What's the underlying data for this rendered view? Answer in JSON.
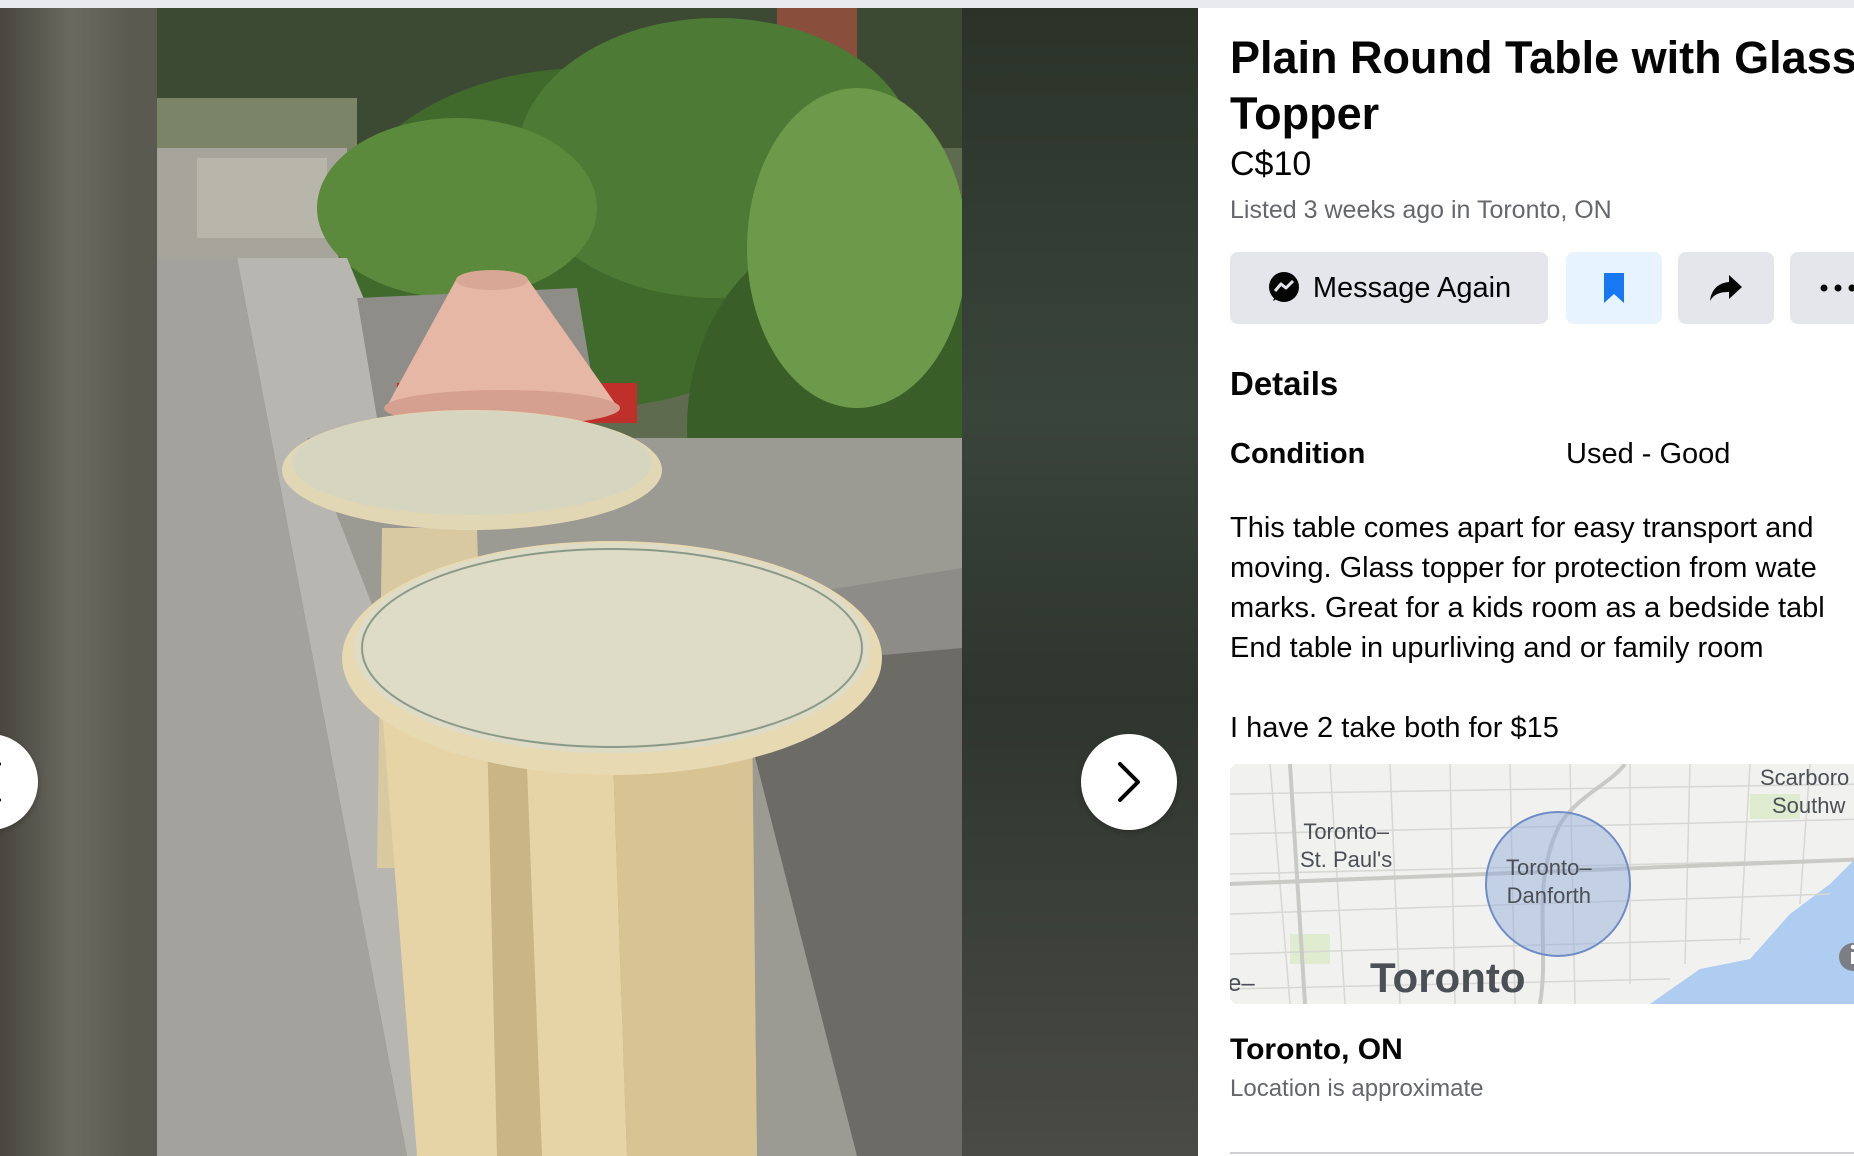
{
  "listing": {
    "title_line1": "Plain Round Table with Glass",
    "title_line2": "Topper",
    "price": "C$10",
    "listed_prefix": "Listed 3 weeks ago in ",
    "listed_location": "Toronto, ON"
  },
  "actions": {
    "message_label": "Message Again",
    "message_icon": "messenger-icon",
    "save_icon": "bookmark-icon",
    "share_icon": "share-icon",
    "more_icon": "more-icon"
  },
  "details": {
    "heading": "Details",
    "condition_label": "Condition",
    "condition_value": "Used - Good",
    "description_lines": [
      "This table comes apart for easy transport and",
      "moving. Glass topper for protection from wate",
      "marks. Great for a kids room as a bedside tabl",
      "End table in upurliving and or family room",
      "",
      "I have 2 take both for $15"
    ]
  },
  "map": {
    "labels": {
      "st_pauls_1": "Toronto–",
      "st_pauls_2": "St. Paul's",
      "danforth_1": "Toronto–",
      "danforth_2": "Danforth",
      "scarb_1": "Scarboro",
      "scarb_2": "Southw",
      "city": "Toronto",
      "edge": "e–"
    }
  },
  "location": {
    "title": "Toronto, ON",
    "subtitle": "Location is approximate"
  },
  "colors": {
    "accent": "#1877f2",
    "button_bg": "#e4e6eb",
    "save_bg": "#e7f3ff",
    "secondary_text": "#65676b"
  }
}
